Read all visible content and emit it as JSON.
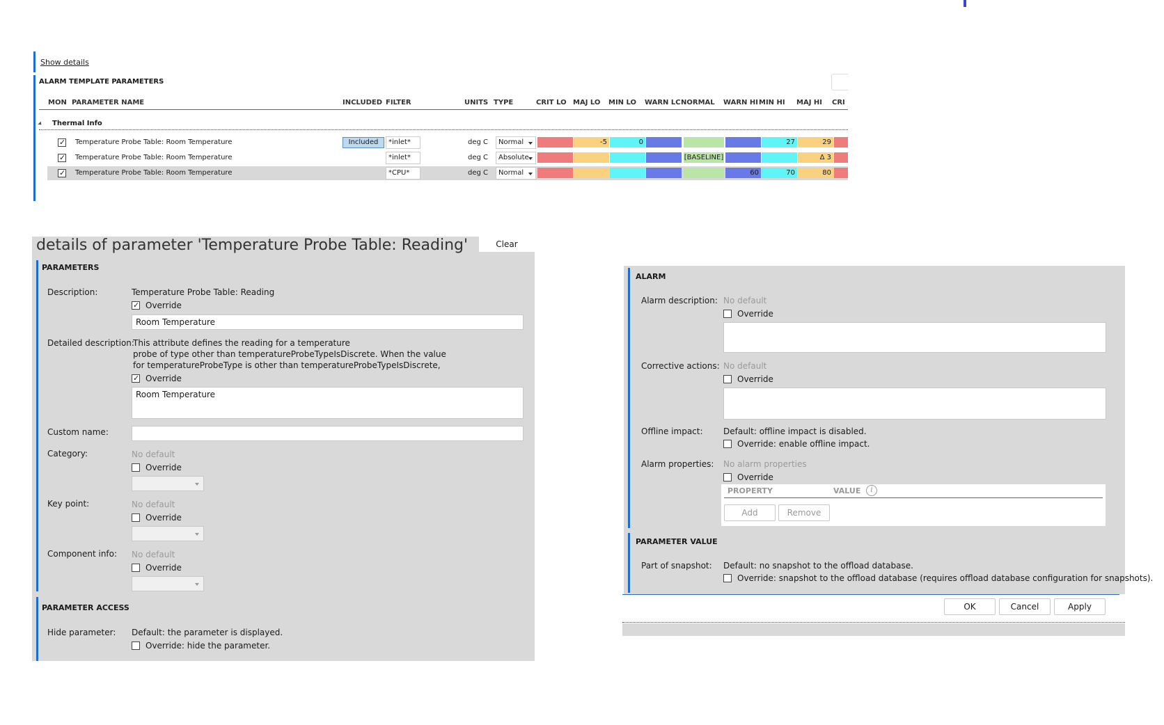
{
  "top": {
    "show_details": "Show details",
    "section_title": "ALARM TEMPLATE PARAMETERS",
    "headers": {
      "mon": "MON",
      "name": "PARAMETER NAME",
      "included": "INCLUDED",
      "filter": "FILTER",
      "units": "UNITS",
      "type": "TYPE",
      "crit_lo": "CRIT LO",
      "maj_lo": "MAJ LO",
      "min_lo": "MIN LO",
      "warn_lo": "WARN LC",
      "normal": "NORMAL",
      "warn_hi": "WARN HI",
      "min_hi": "MIN HI",
      "maj_hi": "MAJ HI",
      "crit": "CRI"
    },
    "group": "Thermal Info",
    "rows": [
      {
        "checked": true,
        "name": "Temperature Probe Table: Room Temperature",
        "included": "Included",
        "filter": "*inlet*",
        "units": "deg C",
        "type": "Normal",
        "crit_lo": "",
        "maj_lo": "-5",
        "min_lo": "0",
        "warn_lo": "",
        "normal": "",
        "warn_hi": "",
        "min_hi": "27",
        "maj_hi": "29",
        "crit": ""
      },
      {
        "checked": true,
        "name": "Temperature Probe Table: Room Temperature",
        "included": "",
        "filter": "*inlet*",
        "units": "deg C",
        "type": "Absolute",
        "crit_lo": "",
        "maj_lo": "",
        "min_lo": "",
        "warn_lo": "",
        "normal": "[BASELINE]",
        "warn_hi": "",
        "min_hi": "",
        "maj_hi": "Δ 3",
        "crit": ""
      },
      {
        "checked": true,
        "name": "Temperature Probe Table: Room Temperature",
        "included": "",
        "filter": "*CPU*",
        "units": "deg C",
        "type": "Normal",
        "crit_lo": "",
        "maj_lo": "",
        "min_lo": "",
        "warn_lo": "",
        "normal": "",
        "warn_hi": "60",
        "min_hi": "70",
        "maj_hi": "80",
        "crit": ""
      }
    ]
  },
  "details": {
    "title": "details of parameter 'Temperature Probe Table: Reading'",
    "clear": "Clear",
    "parameters_title": "PARAMETERS",
    "description_label": "Description:",
    "description_value": "Temperature Probe Table: Reading",
    "override": "Override",
    "description_override_value": "Room Temperature",
    "detailed_label": "Detailed description:",
    "detailed_line1": "This attribute defines the reading for a temperature",
    "detailed_line2": "probe of type other than temperatureProbeTypeIsDiscrete.  When the value",
    "detailed_line3": "for temperatureProbeType is other than temperatureProbeTypeIsDiscrete,",
    "detailed_override_value": "Room Temperature",
    "custom_name_label": "Custom name:",
    "category_label": "Category:",
    "key_point_label": "Key point:",
    "component_info_label": "Component info:",
    "no_default": "No default",
    "access_title": "PARAMETER ACCESS",
    "hide_label": "Hide parameter:",
    "hide_default": "Default: the parameter is displayed.",
    "hide_override": "Override: hide the parameter."
  },
  "alarm": {
    "title": "ALARM",
    "alarm_desc_label": "Alarm description:",
    "no_default": "No default",
    "override": "Override",
    "corrective_label": "Corrective actions:",
    "offline_label": "Offline impact:",
    "offline_default": "Default: offline impact is disabled.",
    "offline_override": "Override: enable offline impact.",
    "props_label": "Alarm properties:",
    "no_props": "No alarm properties",
    "prop_col": "PROPERTY",
    "value_col": "VALUE",
    "info_glyph": "i",
    "add": "Add",
    "remove": "Remove",
    "pv_title": "PARAMETER VALUE",
    "snapshot_label": "Part of snapshot:",
    "snapshot_default": "Default: no snapshot to the offload database.",
    "snapshot_override": "Override: snapshot to the offload database (requires offload database configuration for snapshots).",
    "ok": "OK",
    "cancel": "Cancel",
    "apply": "Apply"
  }
}
